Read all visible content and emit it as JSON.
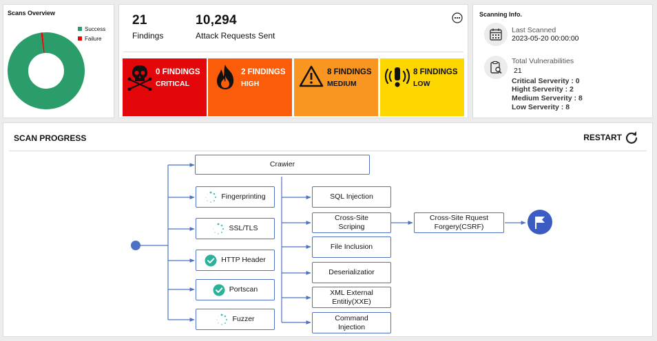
{
  "overview": {
    "title": "Scans Overview",
    "legend": [
      {
        "label": "Success",
        "color": "#2a9d6a"
      },
      {
        "label": "Failure",
        "color": "#e3060a"
      }
    ],
    "chart_data": {
      "type": "pie",
      "categories": [
        "Success",
        "Failure"
      ],
      "values": [
        99,
        1
      ]
    }
  },
  "summary": {
    "findings_count": "21",
    "findings_label": "Findings",
    "requests_count": "10,294",
    "requests_label": "Attack Requests Sent"
  },
  "severity": [
    {
      "count": "0 FINDINGS",
      "label": "CRITICAL",
      "icon": "skull-crossbones-icon",
      "color": "#e3060a"
    },
    {
      "count": "2 FINDINGS",
      "label": "HIGH",
      "icon": "fire-icon",
      "color": "#fa5c0a"
    },
    {
      "count": "8 FINDINGS",
      "label": "MEDIUM",
      "icon": "warning-triangle-icon",
      "color": "#f99521"
    },
    {
      "count": "8 FINDINGS",
      "label": "LOW",
      "icon": "alarm-icon",
      "color": "#fed600"
    }
  ],
  "info": {
    "title": "Scanning Info.",
    "last_scanned_label": "Last Scanned",
    "last_scanned_value": "2023-05-20 00:00:00",
    "total_label": "Total Vulnerabilities",
    "total_value": "21",
    "lines": [
      "Critical Serverity : 0",
      "Hight Serverity : 2",
      "Medium Serverity : 8",
      "Low Serverity : 8"
    ]
  },
  "progress": {
    "title": "SCAN PROGRESS",
    "restart_label": "RESTART",
    "nodes": {
      "crawler": "Crawier",
      "fingerprinting": "Fingerprinting",
      "ssl": "SSL/TLS",
      "http_header": "HTTP Header",
      "portscan": "Portscan",
      "fuzzer": "Fuzzer",
      "sqli": "SQL Injection",
      "xss": "Cross-Site Scriping",
      "file_inclusion": "File Inclusion",
      "deserialization": "Deserializatior",
      "xxe": "XML External Entitiy(XXE)",
      "cmd_injection": "Command Injection",
      "csrf": "Cross-Site Rquest Forgery(CSRF)"
    },
    "status": {
      "fingerprinting": "loading",
      "ssl": "loading",
      "http_header": "done",
      "portscan": "done",
      "fuzzer": "loading"
    }
  }
}
